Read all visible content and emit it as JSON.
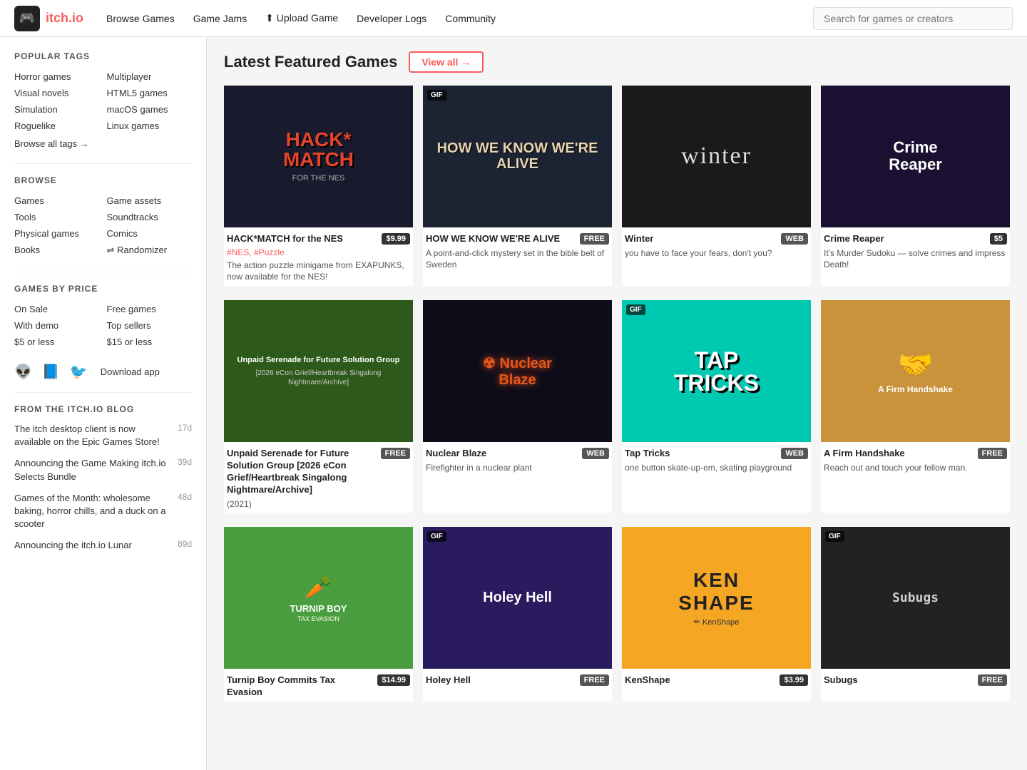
{
  "nav": {
    "logo_text": "itch.io",
    "links": [
      {
        "label": "Browse Games",
        "name": "browse-games-link"
      },
      {
        "label": "Game Jams",
        "name": "game-jams-link"
      },
      {
        "label": "⬆ Upload Game",
        "name": "upload-game-link"
      },
      {
        "label": "Developer Logs",
        "name": "developer-logs-link"
      },
      {
        "label": "Community",
        "name": "community-link"
      }
    ],
    "search_placeholder": "Search for games or creators"
  },
  "sidebar": {
    "popular_tags_title": "POPULAR TAGS",
    "tags_col1": [
      "Horror games",
      "Visual novels",
      "Simulation",
      "Roguelike"
    ],
    "tags_col2": [
      "Multiplayer",
      "HTML5 games",
      "macOS games",
      "Linux games"
    ],
    "browse_all": "Browse all tags →",
    "browse_title": "BROWSE",
    "browse_col1": [
      "Games",
      "Tools",
      "Physical games",
      "Books"
    ],
    "browse_col2": [
      "Game assets",
      "Soundtracks",
      "Comics",
      "⇌ Randomizer"
    ],
    "price_title": "GAMES BY PRICE",
    "price_col1": [
      "On Sale",
      "With demo",
      "$5 or less"
    ],
    "price_col2": [
      "Free games",
      "Top sellers",
      "$15 or less"
    ],
    "social_icons": [
      "reddit",
      "facebook",
      "twitter"
    ],
    "download_app": "Download app",
    "blog_title": "FROM THE ITCH.IO BLOG",
    "blog_items": [
      {
        "text": "The itch desktop client is now available on the Epic Games Store!",
        "age": "17d"
      },
      {
        "text": "Announcing the Game Making itch.io Selects Bundle",
        "age": "39d"
      },
      {
        "text": "Games of the Month: wholesome baking, horror chills, and a duck on a scooter",
        "age": "48d"
      },
      {
        "text": "Announcing the itch.io Lunar",
        "age": "89d"
      }
    ]
  },
  "main": {
    "section_title": "Latest Featured Games",
    "view_all": "View all →",
    "games": [
      {
        "id": "hackMatch",
        "title": "HACK*MATCH for the NES",
        "price": "$9.99",
        "price_type": "paid",
        "tags": "#NES, #Puzzle",
        "desc": "The action puzzle minigame from EXAPUNKS, now available for the NES!",
        "has_gif": false,
        "thumb_label": "HACK\nMATCH",
        "thumb_class": "thumb-hackMatch"
      },
      {
        "id": "howWe",
        "title": "HOW WE KNOW WE'RE ALIVE",
        "price": "FREE",
        "price_type": "free",
        "tags": "",
        "desc": "A point-and-click mystery set in the bible belt of Sweden",
        "has_gif": true,
        "thumb_label": "HOW WE KNOW WE'RE ALIVE",
        "thumb_class": "thumb-howWe"
      },
      {
        "id": "winter",
        "title": "Winter",
        "price": "WEB",
        "price_type": "web",
        "tags": "",
        "desc": "you have to face your fears, don't you?",
        "has_gif": false,
        "thumb_label": "winter",
        "thumb_class": "thumb-winter"
      },
      {
        "id": "crimereaper",
        "title": "Crime Reaper",
        "price": "$5",
        "price_type": "paid",
        "tags": "",
        "desc": "It's Murder Sudoku — solve crimes and impress Death!",
        "has_gif": false,
        "thumb_label": "Crime Reaper",
        "thumb_class": "thumb-crimereaper"
      },
      {
        "id": "unpaid",
        "title": "Unpaid Serenade for Future Solution Group [2026 eCon Grief/Heartbreak Singalong Nightmare/Archive]",
        "price": "FREE",
        "price_type": "free",
        "tags": "",
        "desc": "(2021)",
        "has_gif": false,
        "thumb_label": "Unpaid Serenade for Future Solution Group\n[2026 eCon Grief/Heartbreak Singalong Nightmare/Archive]",
        "thumb_class": "thumb-unpaid"
      },
      {
        "id": "nuclear",
        "title": "Nuclear Blaze",
        "price": "WEB",
        "price_type": "web",
        "tags": "",
        "desc": "Firefighter in a nuclear plant",
        "has_gif": false,
        "thumb_label": "Nuclear Blaze",
        "thumb_class": "thumb-nuclear"
      },
      {
        "id": "tap",
        "title": "Tap Tricks",
        "price": "WEB",
        "price_type": "web",
        "tags": "",
        "desc": "one button skate-up-em, skating playground",
        "has_gif": true,
        "thumb_label": "TAP TRICKS",
        "thumb_class": "thumb-tap"
      },
      {
        "id": "firm",
        "title": "A Firm Handshake",
        "price": "FREE",
        "price_type": "free",
        "tags": "",
        "desc": "Reach out and touch your fellow man.",
        "has_gif": false,
        "thumb_label": "A Firm Handshake",
        "thumb_class": "thumb-firm"
      },
      {
        "id": "turnip",
        "title": "Turnip Boy Commits Tax Evasion",
        "price": "$14.99",
        "price_type": "paid",
        "tags": "",
        "desc": "",
        "has_gif": false,
        "thumb_label": "Turnip Boy",
        "thumb_class": "thumb-turnip"
      },
      {
        "id": "holey",
        "title": "Holey Hell",
        "price": "FREE",
        "price_type": "free",
        "tags": "",
        "desc": "",
        "has_gif": true,
        "thumb_label": "Holey Hell",
        "thumb_class": "thumb-holey"
      },
      {
        "id": "kenshape",
        "title": "KenShape",
        "price": "$3.99",
        "price_type": "paid",
        "tags": "",
        "desc": "",
        "has_gif": false,
        "thumb_label": "KEN SHAPE",
        "thumb_class": "thumb-kenshape"
      },
      {
        "id": "subugs",
        "title": "Subugs",
        "price": "FREE",
        "price_type": "free",
        "tags": "",
        "desc": "",
        "has_gif": true,
        "thumb_label": "Subugs",
        "thumb_class": "thumb-subugs"
      }
    ]
  }
}
